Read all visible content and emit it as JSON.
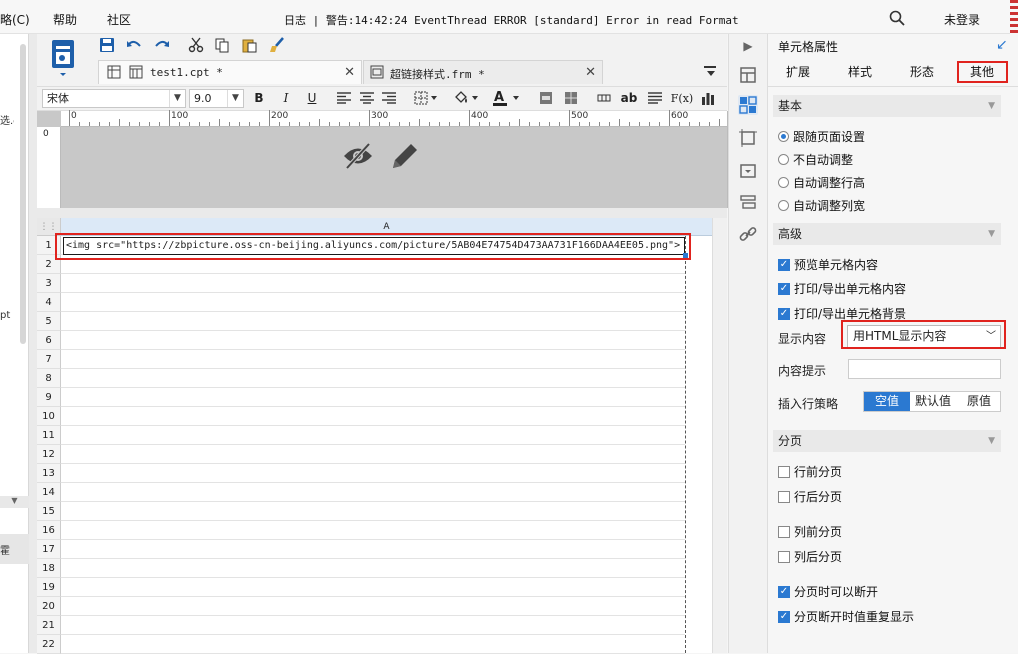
{
  "menubar": {
    "items": [
      "略(C)",
      "帮助",
      "社区"
    ],
    "log_label": "日志",
    "log_message": "警告:14:42:24 EventThread ERROR [standard] Error in read Format",
    "login": "未登录"
  },
  "left_strip": {
    "frag1": "选.c",
    "frag2": "pt",
    "frag3": "霍"
  },
  "tabs": [
    {
      "label": "test1.cpt *"
    },
    {
      "label": "超链接样式.frm *"
    }
  ],
  "format_bar": {
    "font_family": "宋体",
    "font_size": "9.0",
    "bold": "B",
    "italic": "I",
    "underline": "U",
    "text_ab": "ab",
    "fx": "F(x)"
  },
  "ruler": {
    "ticks": [
      "0",
      "100",
      "200",
      "300",
      "400",
      "500",
      "600"
    ]
  },
  "sheet": {
    "column_a": "A",
    "cell_a1": "<img src=\"https://zbpicture.oss-cn-beijing.aliyuncs.com/picture/5AB04E74754D473AA731F166DAA4EE05.png\">",
    "rows": [
      "1",
      "2",
      "3",
      "4",
      "5",
      "6",
      "7",
      "8",
      "9",
      "10",
      "11",
      "12",
      "13",
      "14",
      "15",
      "16",
      "17",
      "18",
      "19",
      "20",
      "21",
      "22"
    ]
  },
  "props": {
    "title": "单元格属性",
    "tabs": [
      "扩展",
      "样式",
      "形态",
      "其他"
    ],
    "active_tab": "其他",
    "basic": {
      "title": "基本",
      "options": [
        "跟随页面设置",
        "不自动调整",
        "自动调整行高",
        "自动调整列宽"
      ],
      "selected": "跟随页面设置"
    },
    "advanced": {
      "title": "高级",
      "checks": [
        "预览单元格内容",
        "打印/导出单元格内容",
        "打印/导出单元格背景"
      ],
      "display_label": "显示内容",
      "display_value": "用HTML显示内容",
      "tooltip_label": "内容提示",
      "tooltip_value": "",
      "insert_label": "插入行策略",
      "insert_options": [
        "空值",
        "默认值",
        "原值"
      ],
      "insert_selected": "空值"
    },
    "paging": {
      "title": "分页",
      "checks": [
        {
          "label": "行前分页",
          "on": false
        },
        {
          "label": "行后分页",
          "on": false
        },
        {
          "label": "列前分页",
          "on": false
        },
        {
          "label": "列后分页",
          "on": false
        },
        {
          "label": "分页时可以断开",
          "on": true
        },
        {
          "label": "分页断开时值重复显示",
          "on": true
        }
      ]
    }
  },
  "colors": {
    "accent": "#2b79d1",
    "highlight": "#e0231e",
    "colhead": "#dce9f7"
  }
}
